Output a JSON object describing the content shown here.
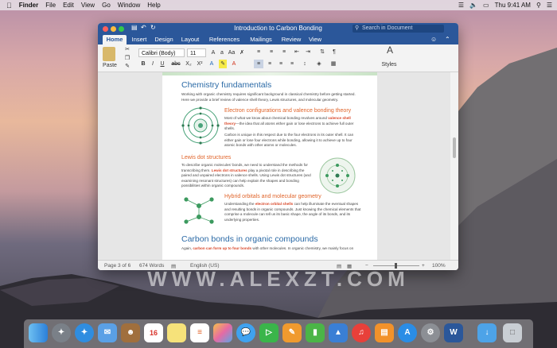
{
  "menubar": {
    "items": [
      "Finder",
      "File",
      "Edit",
      "View",
      "Go",
      "Window",
      "Help"
    ],
    "clock": "Thu 9:41 AM"
  },
  "window": {
    "title": "Introduction to Carbon Bonding",
    "search_placeholder": "Search in Document"
  },
  "tabs": [
    "Home",
    "Insert",
    "Design",
    "Layout",
    "References",
    "Mailings",
    "Review",
    "View"
  ],
  "ribbon": {
    "paste_label": "Paste",
    "font_name": "Calibri (Body)",
    "font_size": "11",
    "styles_label": "Styles",
    "format_buttons": [
      "B",
      "I",
      "U",
      "abc",
      "X₂",
      "X²"
    ]
  },
  "document": {
    "heading1": "Chemistry fundamentals",
    "intro": "Working with organic chemistry requires significant background in classical chemistry before getting started. Here we provide a brief review of valence shell theory, Lewis structures, and molecular geometry.",
    "sec1_title": "Electron configurations and valence bonding theory",
    "sec1_p1_a": "Most of what we know about chemical bonding revolves around ",
    "sec1_p1_hl": "valence shell theory",
    "sec1_p1_b": "—the idea that all atoms either gain or lose electrons to achieve full outer shells.",
    "sec1_p2": "Carbon is unique in this respect due to the four electrons in its outer shell. It can either gain or lose four electrons while bonding, allowing it to achieve up to four atomic bonds with other atoms or molecules.",
    "sec2_title": "Lewis dot structures",
    "sec2_p_a": "To describe organic molecules' bonds, we need to understand the methods for transcribing them. ",
    "sec2_p_hl": "Lewis dot structures",
    "sec2_p_b": " play a pivotal role in describing the paired and unpaired electrons in valence shells. Using Lewis dot structures (and examining resonant structures) can help explain the shapes and bonding possibilities within organic compounds.",
    "sec3_title": "Hybrid orbitals and molecular geometry",
    "sec3_p_a": "Understanding the ",
    "sec3_p_hl": "electron orbital shells",
    "sec3_p_b": " can help illuminate the eventual shapes and resulting bonds in organic compounds. Just knowing the chemical elements that comprise a molecule can tell us its basic shape, the angle of its bonds, and its underlying properties.",
    "heading2": "Carbon bonds in organic compounds",
    "last_a": "Again, ",
    "last_hl": "carbon can form up to four bonds",
    "last_b": " with other molecules. In organic chemistry, we mainly focus on"
  },
  "statusbar": {
    "page": "Page 3 of 6",
    "words": "674 Words",
    "language": "English (US)",
    "zoom": "100%"
  },
  "watermark": "WWW.ALEXZT.COM",
  "dock_icons": [
    "finder-icon",
    "launchpad-icon",
    "safari-icon",
    "mail-icon",
    "contacts-icon",
    "calendar-icon",
    "notes-icon",
    "reminders-icon",
    "photos-icon",
    "messages-icon",
    "facetime-icon",
    "pages-icon",
    "numbers-icon",
    "keynote-icon",
    "itunes-icon",
    "ibooks-icon",
    "app-store-icon",
    "system-preferences-icon",
    "word-icon",
    "downloads-icon",
    "trash-icon"
  ],
  "calendar_day": "16",
  "colors": {
    "word_blue": "#2b579a",
    "heading_blue": "#2b6aa6",
    "accent_orange": "#e0642a"
  }
}
